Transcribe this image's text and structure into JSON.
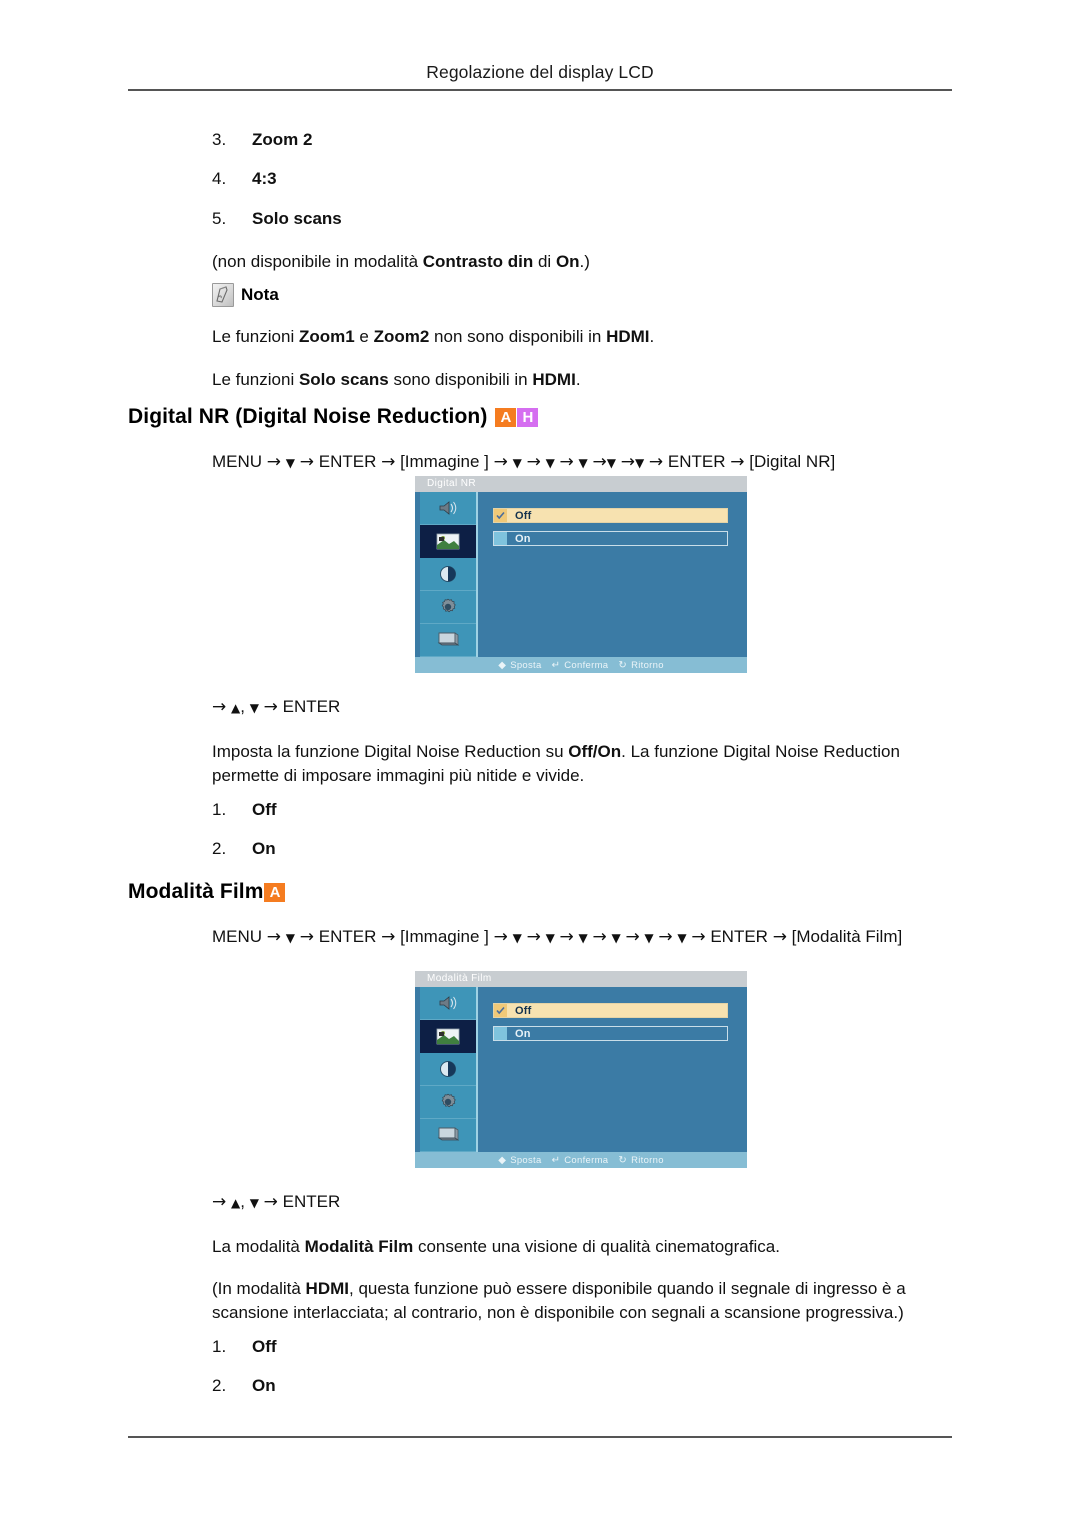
{
  "header": {
    "running_title": "Regolazione del display LCD"
  },
  "top_list": [
    {
      "num": "3.",
      "value": "Zoom 2"
    },
    {
      "num": "4.",
      "value": "4:3"
    },
    {
      "num": "5.",
      "value": "Solo scans"
    }
  ],
  "availability_note": {
    "prefix": "(non disponibile in modalità ",
    "bold1": "Contrasto din",
    "middle": " di ",
    "bold2": "On",
    "suffix": ".)"
  },
  "nota": {
    "label": "Nota",
    "icon": "note-pencil-icon",
    "lines": [
      {
        "a": "Le funzioni ",
        "b1": "Zoom1",
        "c": " e ",
        "b2": "Zoom2",
        "d": " non sono disponibili in ",
        "b3": "HDMI",
        "e": "."
      },
      {
        "a": "Le funzioni ",
        "b1": "Solo scans",
        "c": " sono disponibili in ",
        "b2": "HDMI",
        "d": "."
      }
    ]
  },
  "sections": [
    {
      "id": "digital-nr",
      "heading": "Digital NR (Digital Noise Reduction)",
      "badges": [
        "A",
        "H"
      ],
      "badge_colors": {
        "A": "#f57c20",
        "H": "#d56ef0"
      },
      "navpath": {
        "menu": "MENU",
        "enter": "ENTER",
        "bracket_menu": "[Immagine ]",
        "down_count": 5,
        "target": "[Digital NR]"
      },
      "osd": {
        "title": "Digital  NR",
        "options": [
          {
            "label": "Off",
            "selected": true
          },
          {
            "label": "On",
            "selected": false
          }
        ],
        "sidebar_icons": [
          "audio-speaker-icon",
          "picture-image-icon",
          "color-contrast-icon",
          "setup-gear-icon",
          "display-monitor-icon"
        ],
        "selected_sidebar_index": 1,
        "footer": [
          {
            "glyph": "♦",
            "label": "Sposta"
          },
          {
            "glyph": "↲",
            "label": "Conferma"
          },
          {
            "glyph": "↺",
            "label": "Ritorno"
          }
        ]
      },
      "keyline": {
        "prefix": "→",
        "up": "▲",
        "sep": ",",
        "down": "▼",
        "arrow": "→",
        "enter": "ENTER"
      },
      "description": {
        "a": "Imposta la funzione Digital Noise Reduction su ",
        "b1": "Off/On",
        "c": ". La funzione Digital Noise Reduction permette di imposare immagini più nitide e vivide."
      },
      "options_list": [
        {
          "num": "1.",
          "value": "Off"
        },
        {
          "num": "2.",
          "value": "On"
        }
      ]
    },
    {
      "id": "modalita-film",
      "heading": "Modalità Film",
      "badges": [
        "A"
      ],
      "badge_colors": {
        "A": "#f57c20"
      },
      "navpath": {
        "menu": "MENU",
        "enter": "ENTER",
        "bracket_menu": "[Immagine ]",
        "down_count": 6,
        "target": "[Modalità Film]"
      },
      "osd": {
        "title": "Modalità Film",
        "options": [
          {
            "label": "Off",
            "selected": true
          },
          {
            "label": "On",
            "selected": false
          }
        ],
        "sidebar_icons": [
          "audio-speaker-icon",
          "picture-image-icon",
          "color-contrast-icon",
          "setup-gear-icon",
          "display-monitor-icon"
        ],
        "selected_sidebar_index": 1,
        "footer": [
          {
            "glyph": "♦",
            "label": "Sposta"
          },
          {
            "glyph": "↲",
            "label": "Conferma"
          },
          {
            "glyph": "↺",
            "label": "Ritorno"
          }
        ]
      },
      "keyline": {
        "prefix": "→",
        "up": "▲",
        "sep": ",",
        "down": "▼",
        "arrow": "→",
        "enter": "ENTER"
      },
      "description": {
        "a": "La modalità ",
        "b1": "Modalità Film",
        "c": " consente una visione di qualità cinematografica."
      },
      "hdmi_note": {
        "a": "(In modalità ",
        "b1": "HDMI",
        "c": ", questa funzione può essere disponibile quando il segnale di ingresso è a scansione interlacciata; al contrario, non è disponibile con segnali a scansione progressiva.)"
      },
      "options_list": [
        {
          "num": "1.",
          "value": "Off"
        },
        {
          "num": "2.",
          "value": "On"
        }
      ]
    }
  ]
}
